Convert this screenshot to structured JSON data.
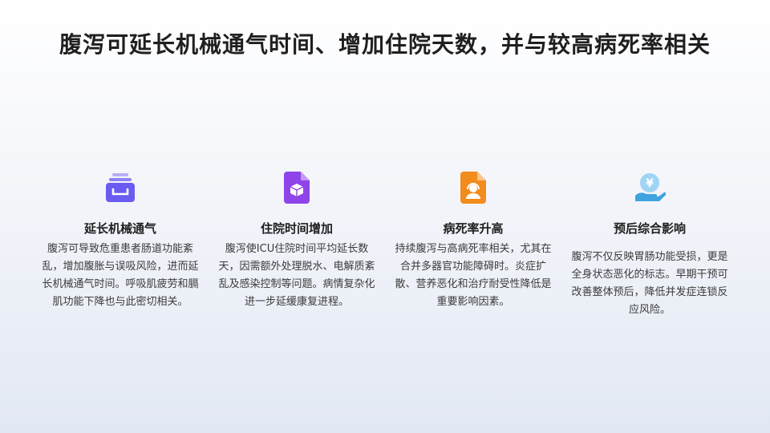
{
  "slide": {
    "title": "腹泻可延长机械通气时间、增加住院天数，并与较高病死率相关"
  },
  "cards": [
    {
      "icon": "inbox-tray-icon",
      "color": "#6a5cf0",
      "heading": "延长机械通气",
      "body": "腹泻可导致危重患者肠道功能紊乱，增加腹胀与误吸风险，进而延长机械通气时间。呼吸肌疲劳和膈肌功能下降也与此密切相关。"
    },
    {
      "icon": "document-box-icon",
      "color": "#8e44e8",
      "heading": "住院时间增加",
      "body": "腹泻使ICU住院时间平均延长数天，因需额外处理脱水、电解质紊乱及感染控制等问题。病情复杂化进一步延缓康复进程。"
    },
    {
      "icon": "document-support-icon",
      "color": "#f28c1c",
      "heading": "病死率升高",
      "body": "持续腹泻与高病死率相关，尤其在合并多器官功能障碍时。炎症扩散、营养恶化和治疗耐受性降低是重要影响因素。"
    },
    {
      "icon": "yen-hand-icon",
      "color": "#3fa3e0",
      "heading": "预后综合影响",
      "body": "腹泻不仅反映胃肠功能受损，更是全身状态恶化的标志。早期干预可改善整体预后，降低并发症连锁反应风险。"
    }
  ]
}
